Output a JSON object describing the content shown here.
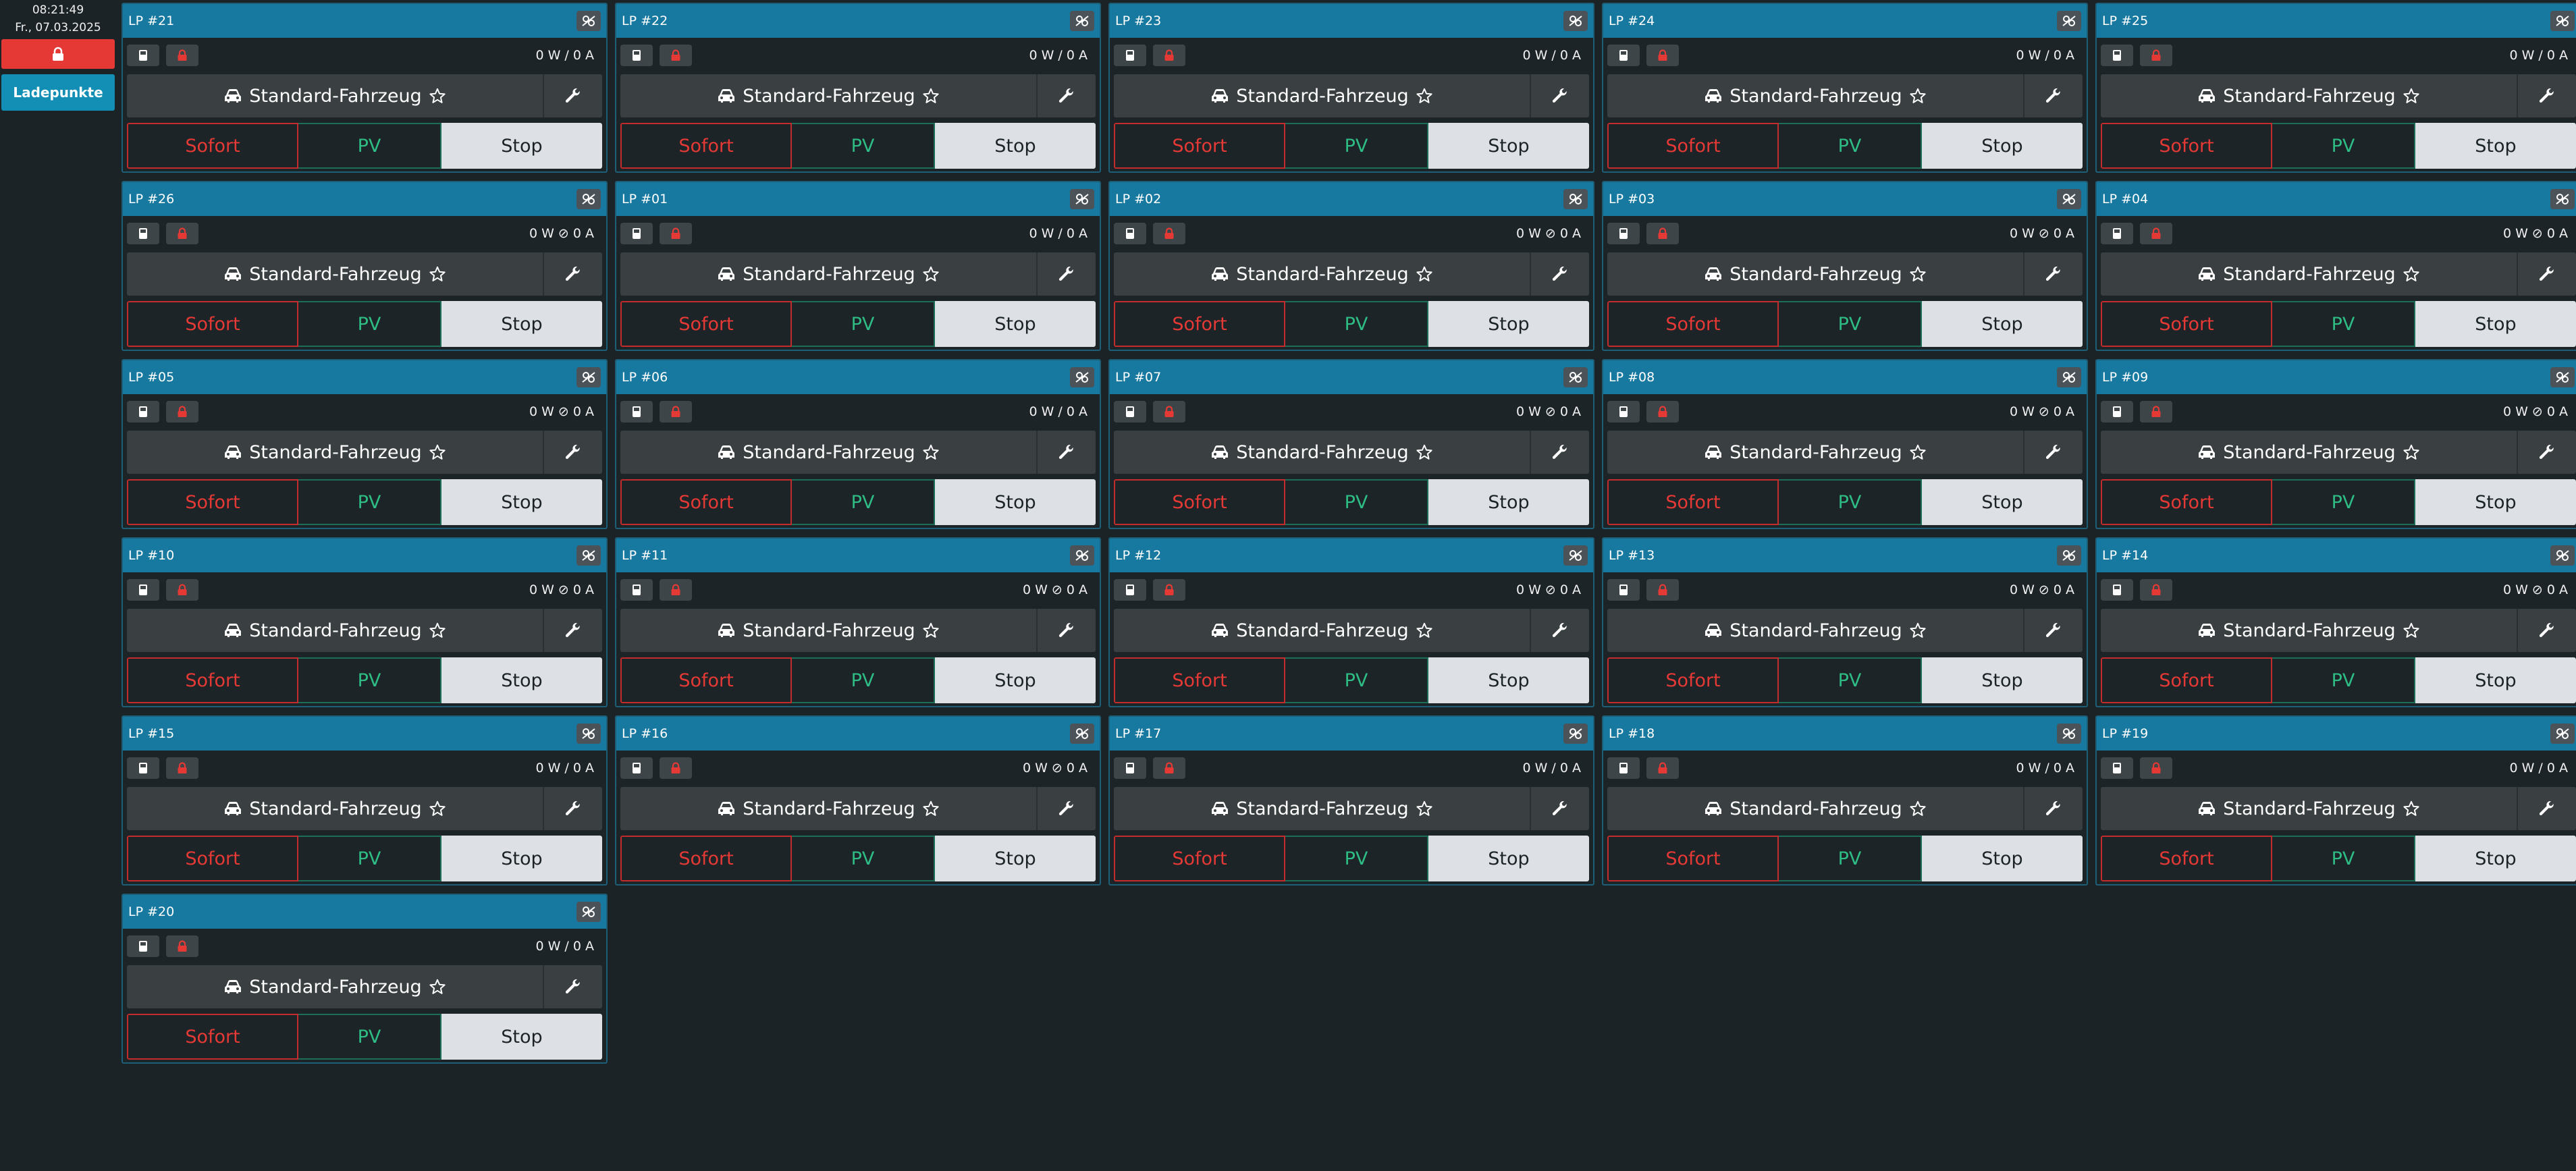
{
  "sidebar": {
    "time": "08:21:49",
    "date": "Fr., 07.03.2025",
    "lock_icon": "lock-icon",
    "nav_label": "Ladepunkte"
  },
  "colors": {
    "header": "#17799f",
    "sofort": "#e53935",
    "pv": "#2ebd85",
    "stop_bg": "#dde1e5",
    "lock": "#e53935"
  },
  "cards": [
    {
      "title": "LP #21",
      "power": "0 W / 0 A",
      "vehicle": "Standard-Fahrzeug",
      "modes": {
        "sofort": "Sofort",
        "pv": "PV",
        "stop": "Stop"
      }
    },
    {
      "title": "LP #22",
      "power": "0 W / 0 A",
      "vehicle": "Standard-Fahrzeug",
      "modes": {
        "sofort": "Sofort",
        "pv": "PV",
        "stop": "Stop"
      }
    },
    {
      "title": "LP #23",
      "power": "0 W / 0 A",
      "vehicle": "Standard-Fahrzeug",
      "modes": {
        "sofort": "Sofort",
        "pv": "PV",
        "stop": "Stop"
      }
    },
    {
      "title": "LP #24",
      "power": "0 W / 0 A",
      "vehicle": "Standard-Fahrzeug",
      "modes": {
        "sofort": "Sofort",
        "pv": "PV",
        "stop": "Stop"
      }
    },
    {
      "title": "LP #25",
      "power": "0 W / 0 A",
      "vehicle": "Standard-Fahrzeug",
      "modes": {
        "sofort": "Sofort",
        "pv": "PV",
        "stop": "Stop"
      }
    },
    {
      "title": "LP #26",
      "power": "0 W ⊘ 0 A",
      "vehicle": "Standard-Fahrzeug",
      "modes": {
        "sofort": "Sofort",
        "pv": "PV",
        "stop": "Stop"
      }
    },
    {
      "title": "LP #01",
      "power": "0 W / 0 A",
      "vehicle": "Standard-Fahrzeug",
      "modes": {
        "sofort": "Sofort",
        "pv": "PV",
        "stop": "Stop"
      }
    },
    {
      "title": "LP #02",
      "power": "0 W ⊘ 0 A",
      "vehicle": "Standard-Fahrzeug",
      "modes": {
        "sofort": "Sofort",
        "pv": "PV",
        "stop": "Stop"
      }
    },
    {
      "title": "LP #03",
      "power": "0 W ⊘ 0 A",
      "vehicle": "Standard-Fahrzeug",
      "modes": {
        "sofort": "Sofort",
        "pv": "PV",
        "stop": "Stop"
      }
    },
    {
      "title": "LP #04",
      "power": "0 W ⊘ 0 A",
      "vehicle": "Standard-Fahrzeug",
      "modes": {
        "sofort": "Sofort",
        "pv": "PV",
        "stop": "Stop"
      }
    },
    {
      "title": "LP #05",
      "power": "0 W ⊘ 0 A",
      "vehicle": "Standard-Fahrzeug",
      "modes": {
        "sofort": "Sofort",
        "pv": "PV",
        "stop": "Stop"
      }
    },
    {
      "title": "LP #06",
      "power": "0 W / 0 A",
      "vehicle": "Standard-Fahrzeug",
      "modes": {
        "sofort": "Sofort",
        "pv": "PV",
        "stop": "Stop"
      }
    },
    {
      "title": "LP #07",
      "power": "0 W ⊘ 0 A",
      "vehicle": "Standard-Fahrzeug",
      "modes": {
        "sofort": "Sofort",
        "pv": "PV",
        "stop": "Stop"
      }
    },
    {
      "title": "LP #08",
      "power": "0 W ⊘ 0 A",
      "vehicle": "Standard-Fahrzeug",
      "modes": {
        "sofort": "Sofort",
        "pv": "PV",
        "stop": "Stop"
      }
    },
    {
      "title": "LP #09",
      "power": "0 W ⊘ 0 A",
      "vehicle": "Standard-Fahrzeug",
      "modes": {
        "sofort": "Sofort",
        "pv": "PV",
        "stop": "Stop"
      }
    },
    {
      "title": "LP #10",
      "power": "0 W ⊘ 0 A",
      "vehicle": "Standard-Fahrzeug",
      "modes": {
        "sofort": "Sofort",
        "pv": "PV",
        "stop": "Stop"
      }
    },
    {
      "title": "LP #11",
      "power": "0 W ⊘ 0 A",
      "vehicle": "Standard-Fahrzeug",
      "modes": {
        "sofort": "Sofort",
        "pv": "PV",
        "stop": "Stop"
      }
    },
    {
      "title": "LP #12",
      "power": "0 W ⊘ 0 A",
      "vehicle": "Standard-Fahrzeug",
      "modes": {
        "sofort": "Sofort",
        "pv": "PV",
        "stop": "Stop"
      }
    },
    {
      "title": "LP #13",
      "power": "0 W ⊘ 0 A",
      "vehicle": "Standard-Fahrzeug",
      "modes": {
        "sofort": "Sofort",
        "pv": "PV",
        "stop": "Stop"
      }
    },
    {
      "title": "LP #14",
      "power": "0 W ⊘ 0 A",
      "vehicle": "Standard-Fahrzeug",
      "modes": {
        "sofort": "Sofort",
        "pv": "PV",
        "stop": "Stop"
      }
    },
    {
      "title": "LP #15",
      "power": "0 W / 0 A",
      "vehicle": "Standard-Fahrzeug",
      "modes": {
        "sofort": "Sofort",
        "pv": "PV",
        "stop": "Stop"
      }
    },
    {
      "title": "LP #16",
      "power": "0 W ⊘ 0 A",
      "vehicle": "Standard-Fahrzeug",
      "modes": {
        "sofort": "Sofort",
        "pv": "PV",
        "stop": "Stop"
      }
    },
    {
      "title": "LP #17",
      "power": "0 W / 0 A",
      "vehicle": "Standard-Fahrzeug",
      "modes": {
        "sofort": "Sofort",
        "pv": "PV",
        "stop": "Stop"
      }
    },
    {
      "title": "LP #18",
      "power": "0 W / 0 A",
      "vehicle": "Standard-Fahrzeug",
      "modes": {
        "sofort": "Sofort",
        "pv": "PV",
        "stop": "Stop"
      }
    },
    {
      "title": "LP #19",
      "power": "0 W / 0 A",
      "vehicle": "Standard-Fahrzeug",
      "modes": {
        "sofort": "Sofort",
        "pv": "PV",
        "stop": "Stop"
      }
    },
    {
      "title": "LP #20",
      "power": "0 W / 0 A",
      "vehicle": "Standard-Fahrzeug",
      "modes": {
        "sofort": "Sofort",
        "pv": "PV",
        "stop": "Stop"
      }
    }
  ]
}
